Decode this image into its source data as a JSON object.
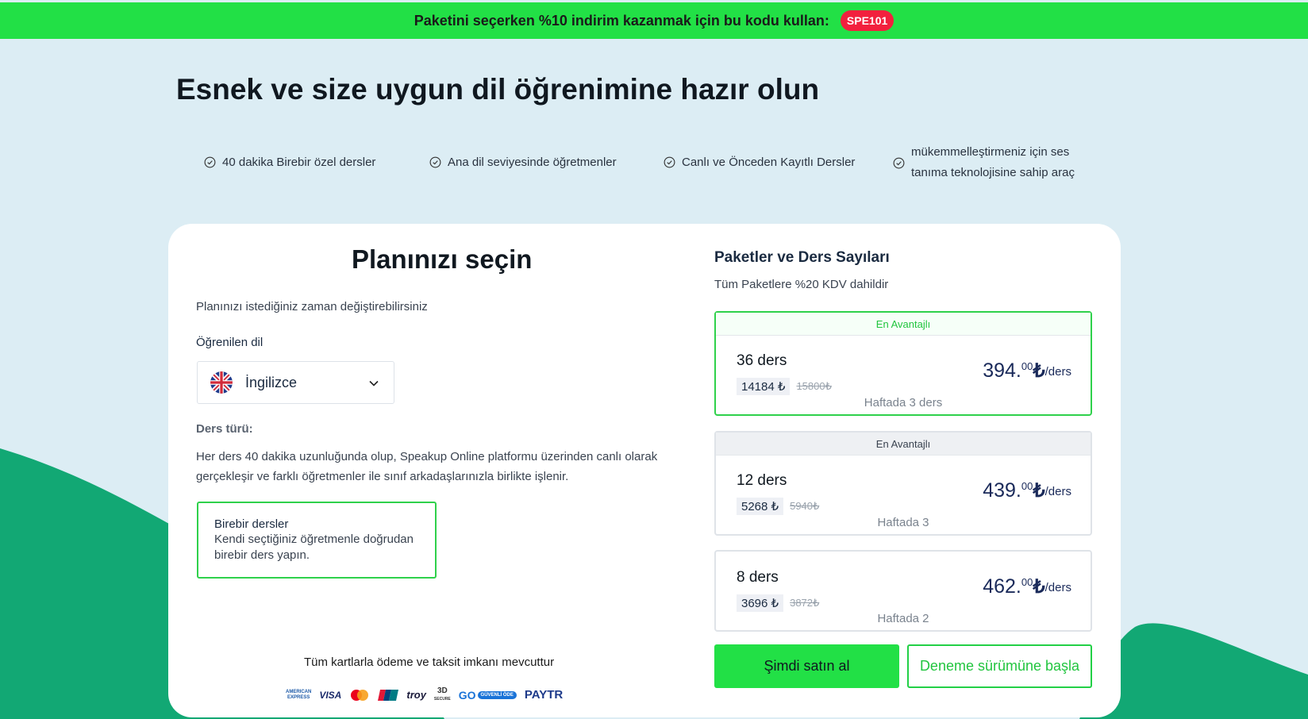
{
  "promo": {
    "text": "Paketini seçerken %10 indirim kazanmak için bu kodu kullan:",
    "code": "SPE101",
    "bar_color": "#22e046",
    "code_color": "#f2203e"
  },
  "hero": {
    "title": "Esnek ve size uygun dil öğrenimine hazır olun"
  },
  "features": [
    {
      "icon": "check-circle-icon",
      "label": "40 dakika Birebir özel dersler"
    },
    {
      "icon": "check-circle-icon",
      "label": "Ana dil seviyesinde öğretmenler"
    },
    {
      "icon": "check-circle-icon",
      "label": "Canlı ve Önceden Kayıtlı Dersler"
    },
    {
      "icon": "check-circle-icon",
      "label_line1": "mükemmelleştirmeniz için ses",
      "label_line2": "tanıma teknolojisine sahip araç"
    }
  ],
  "plan": {
    "title": "Planınızı seçin",
    "subtitle": "Planınızı istediğiniz zaman değiştirebilirsiniz",
    "language_label": "Öğrenilen dil",
    "language_value": "İngilizce",
    "language_flag_icon": "uk-flag-icon",
    "lesson_type_label": "Ders türü:",
    "lesson_type_desc": "Her ders 40 dakika uzunluğunda olup, Speakup Online platformu üzerinden canlı olarak gerçekleşir ve farklı öğretmenler ile sınıf arkadaşlarınızla birlikte işlenir.",
    "lesson_option": {
      "title": "Birebir dersler",
      "desc": "Kendi seçtiğiniz öğretmenle doğrudan birebir ders yapın."
    },
    "payment_text": "Tüm kartlarla ödeme ve taksit imkanı mevcuttur",
    "payment_logos": {
      "amex_line1": "AMERICAN",
      "amex_line2": "EXPRESS",
      "visa": "VISA",
      "troy": "troy",
      "secure_3d_line1": "3D",
      "secure_3d_line2": "SECURE",
      "go": "GO",
      "go_badge": "GÜVENLİ ÖDE",
      "paytr": "PAYTR"
    }
  },
  "packages": {
    "title": "Paketler ve Ders Sayıları",
    "subtitle": "Tüm Paketlere %20 KDV dahildir",
    "items": [
      {
        "ribbon": "En Avantajlı",
        "count": "36 ders",
        "price_now": "14184 ₺",
        "price_old": "15800₺",
        "unit_int": "394.",
        "unit_dec": "00",
        "currency": "₺",
        "per": "/ders",
        "frequency": "Haftada 3 ders",
        "selected": true
      },
      {
        "ribbon": "En Avantajlı",
        "count": "12 ders",
        "price_now": "5268 ₺",
        "price_old": "5940₺",
        "unit_int": "439.",
        "unit_dec": "00",
        "currency": "₺",
        "per": "/ders",
        "frequency": "Haftada 3",
        "selected": false
      },
      {
        "ribbon": "",
        "count": "8 ders",
        "price_now": "3696 ₺",
        "price_old": "3872₺",
        "unit_int": "462.",
        "unit_dec": "00",
        "currency": "₺",
        "per": "/ders",
        "frequency": "Haftada 2",
        "selected": false
      }
    ]
  },
  "actions": {
    "buy": "Şimdi satın al",
    "trial": "Deneme sürümüne başla"
  },
  "colors": {
    "accent_green": "#22e046",
    "wave_green": "#12a874",
    "background": "#dcedf4",
    "price_text": "#1a2a5a"
  }
}
